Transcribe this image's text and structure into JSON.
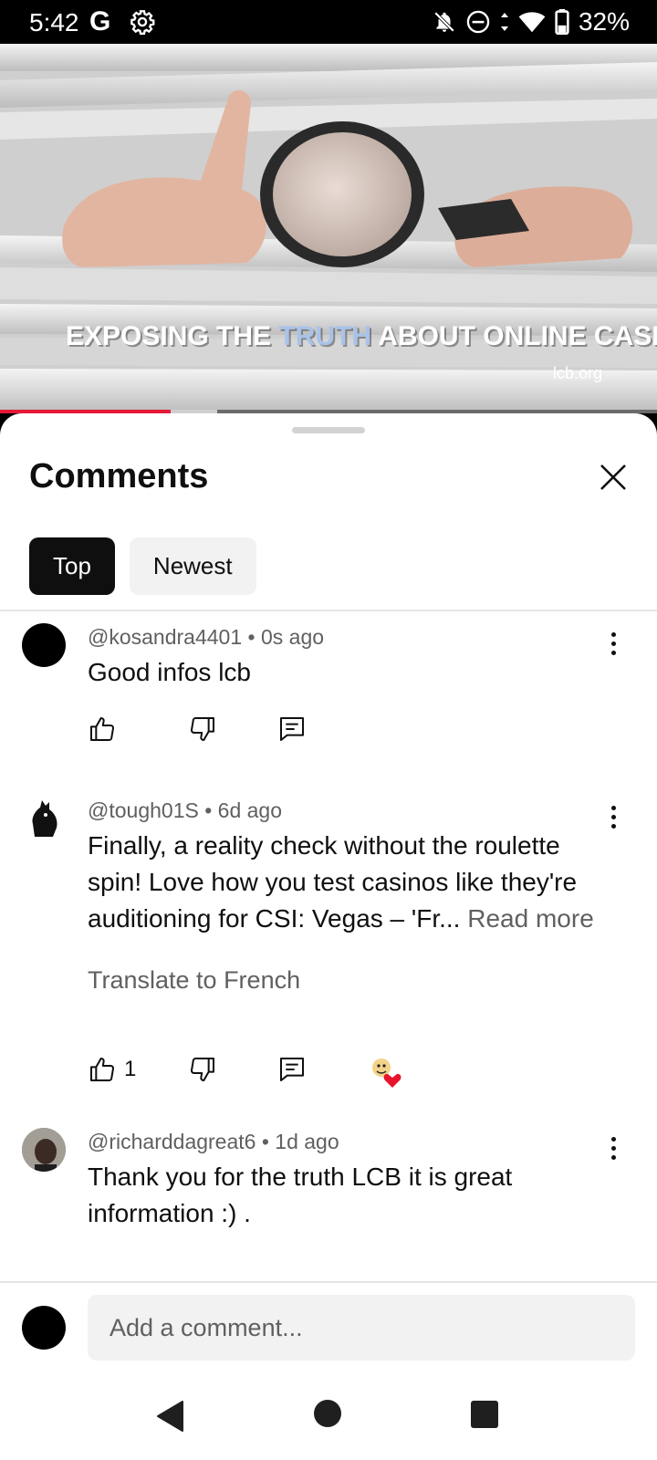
{
  "status_bar": {
    "time": "5:42",
    "google_label": "G",
    "battery": "32%",
    "icons": [
      "settings-icon",
      "notifications-off-icon",
      "do-not-disturb-icon",
      "wifi-icon",
      "battery-icon"
    ]
  },
  "video": {
    "caption_before": "EXPOSING THE ",
    "caption_highlight": "TRUTH",
    "caption_after": " ABOUT ONLINE CASINOS",
    "watermark": "lcb.org",
    "progress": 0.26,
    "buffered": 0.33
  },
  "comments_panel": {
    "title": "Comments",
    "sort_chips": [
      "Top",
      "Newest"
    ],
    "selected_chip": "Top",
    "comments": [
      {
        "author": "@kosandra4401",
        "time": "0s ago",
        "text": "Good infos lcb",
        "likes": ""
      },
      {
        "author": "@tough01S",
        "time": "6d ago",
        "text_lines": [
          "Finally, a reality check without the roulette",
          "spin! Love how you test casinos like they're",
          "auditioning for CSI: Vegas – 'Fr... "
        ],
        "read_more": "Read more",
        "translate": "Translate to French",
        "likes": "1",
        "creator_heart": true
      },
      {
        "author": "@richarddagreat6",
        "time": "1d ago",
        "text_lines": [
          "Thank you for the truth LCB it is great",
          "information :) ."
        ]
      }
    ],
    "composer_placeholder": "Add a comment..."
  },
  "colors": {
    "progress": "#e51937",
    "chip_active": "#0f0f0f",
    "chip_inactive": "#f2f2f2",
    "secondary_text": "#606060",
    "caption_highlight": "#a9c3e8"
  }
}
